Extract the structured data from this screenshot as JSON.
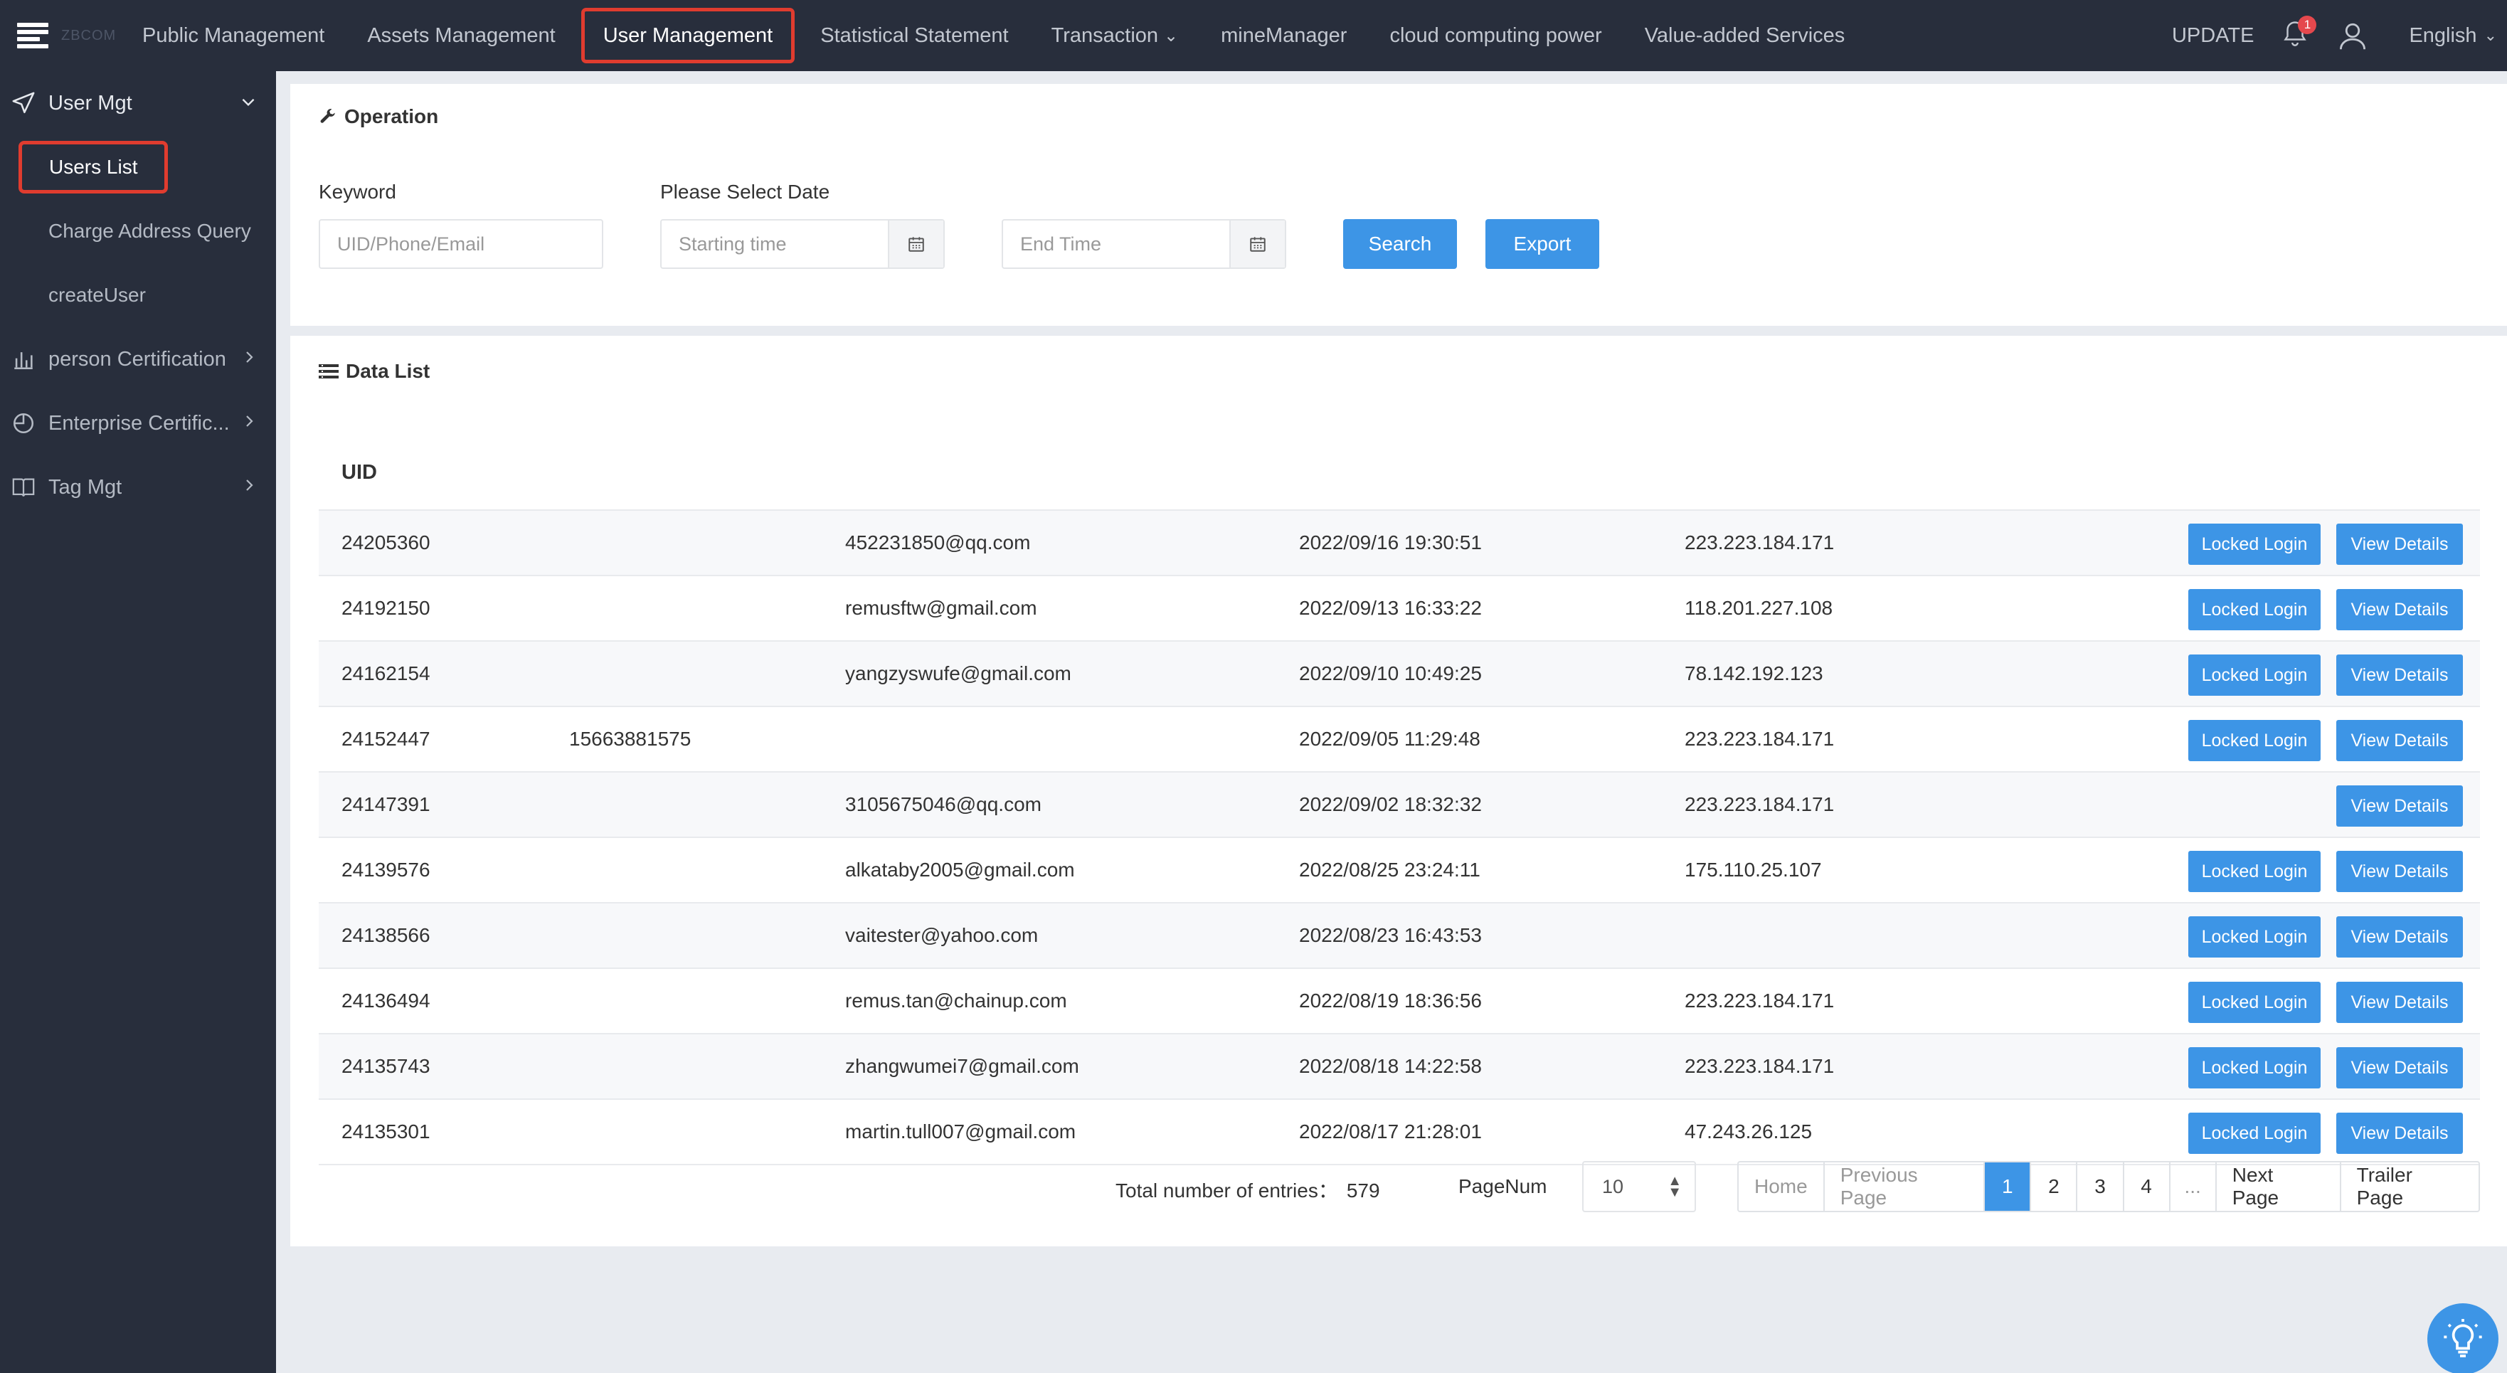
{
  "app": {
    "logo_text": "ZBCOM"
  },
  "nav": {
    "items": [
      {
        "label": "Public Management"
      },
      {
        "label": "Assets Management"
      },
      {
        "label": "User Management"
      },
      {
        "label": "Statistical Statement"
      },
      {
        "label": "Transaction"
      },
      {
        "label": "mineManager"
      },
      {
        "label": "cloud computing power"
      },
      {
        "label": "Value-added Services"
      }
    ],
    "active_index": 2,
    "update_label": "UPDATE",
    "notification_count": "1",
    "language": "English"
  },
  "sidebar": {
    "user_mgt": "User Mgt",
    "users_list": "Users List",
    "charge_address_query": "Charge Address Query",
    "create_user": "createUser",
    "person_certification": "person Certification",
    "enterprise_certification": "Enterprise Certific...",
    "tag_mgt": "Tag Mgt"
  },
  "operation": {
    "title": "Operation",
    "keyword_label": "Keyword",
    "keyword_placeholder": "UID/Phone/Email",
    "date_label": "Please Select Date",
    "start_placeholder": "Starting time",
    "end_placeholder": "End Time",
    "search_label": "Search",
    "export_label": "Export"
  },
  "data_list": {
    "title": "Data List",
    "uid_header": "UID",
    "lock_label": "Locked Login",
    "view_label": "View Details",
    "rows": [
      {
        "uid": "24205360",
        "phone": "",
        "email": "452231850@qq.com",
        "time": "2022/09/16 19:30:51",
        "ip": "223.223.184.171",
        "lock": true
      },
      {
        "uid": "24192150",
        "phone": "",
        "email": "remusftw@gmail.com",
        "time": "2022/09/13 16:33:22",
        "ip": "118.201.227.108",
        "lock": true
      },
      {
        "uid": "24162154",
        "phone": "",
        "email": "yangzyswufe@gmail.com",
        "time": "2022/09/10 10:49:25",
        "ip": "78.142.192.123",
        "lock": true
      },
      {
        "uid": "24152447",
        "phone": "15663881575",
        "email": "",
        "time": "2022/09/05 11:29:48",
        "ip": "223.223.184.171",
        "lock": true
      },
      {
        "uid": "24147391",
        "phone": "",
        "email": "3105675046@qq.com",
        "time": "2022/09/02 18:32:32",
        "ip": "223.223.184.171",
        "lock": false
      },
      {
        "uid": "24139576",
        "phone": "",
        "email": "alkataby2005@gmail.com",
        "time": "2022/08/25 23:24:11",
        "ip": "175.110.25.107",
        "lock": true
      },
      {
        "uid": "24138566",
        "phone": "",
        "email": "vaitester@yahoo.com",
        "time": "2022/08/23 16:43:53",
        "ip": "",
        "lock": true
      },
      {
        "uid": "24136494",
        "phone": "",
        "email": "remus.tan@chainup.com",
        "time": "2022/08/19 18:36:56",
        "ip": "223.223.184.171",
        "lock": true
      },
      {
        "uid": "24135743",
        "phone": "",
        "email": "zhangwumei7@gmail.com",
        "time": "2022/08/18 14:22:58",
        "ip": "223.223.184.171",
        "lock": true
      },
      {
        "uid": "24135301",
        "phone": "",
        "email": "martin.tull007@gmail.com",
        "time": "2022/08/17 21:28:01",
        "ip": "47.243.26.125",
        "lock": true
      }
    ]
  },
  "pagination": {
    "total_label": "Total number of entries：",
    "total": "579",
    "pagenum_label": "PageNum",
    "page_size": "10",
    "home": "Home",
    "previous": "Previous Page",
    "pages": [
      "1",
      "2",
      "3",
      "4"
    ],
    "current_page": "1",
    "ellipsis": "...",
    "next": "Next Page",
    "trailer": "Trailer Page"
  },
  "colors": {
    "primary": "#3d95e6",
    "topbar": "#282e3c",
    "highlight": "#e03c2f"
  }
}
